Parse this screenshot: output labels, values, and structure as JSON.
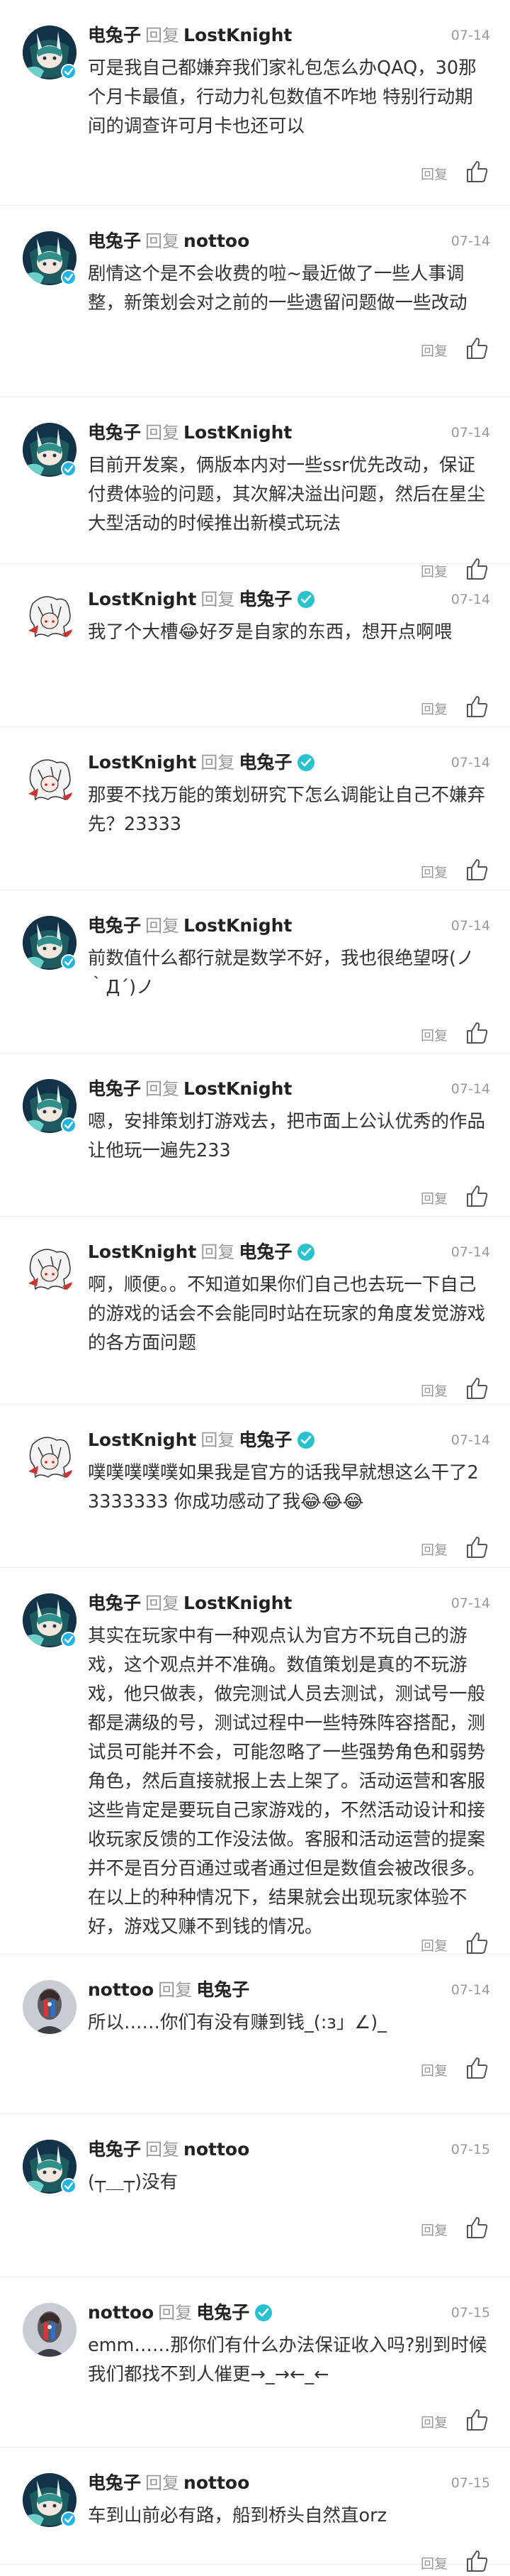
{
  "ui": {
    "reply_word": "回复",
    "reply_button": "回复"
  },
  "comments": [
    {
      "author": "电兔子",
      "author_avatar": "rabbit",
      "target": "LostKnight",
      "date": "07-14",
      "text": "可是我自己都嫌弃我们家礼包怎么办QAQ，30那个月卡最值，行动力礼包数值不咋地 特别行动期间的调查许可月卡也还可以"
    },
    {
      "author": "电兔子",
      "author_avatar": "rabbit",
      "target": "nottoo",
      "date": "07-14",
      "text": "剧情这个是不会收费的啦~最近做了一些人事调整，新策划会对之前的一些遗留问题做一些改动"
    },
    {
      "author": "电兔子",
      "author_avatar": "rabbit",
      "target": "LostKnight",
      "date": "07-14",
      "text": "目前开发案，俩版本内对一些ssr优先改动，保证付费体验的问题，其次解决溢出问题，然后在星尘大型活动的时候推出新模式玩法"
    },
    {
      "author": "LostKnight",
      "author_avatar": "knight",
      "target": "电兔子",
      "target_verified": true,
      "date": "07-14",
      "text": "我了个大槽😂好歹是自家的东西，想开点啊喂"
    },
    {
      "author": "LostKnight",
      "author_avatar": "knight",
      "target": "电兔子",
      "target_verified": true,
      "date": "07-14",
      "text": "那要不找万能的策划研究下怎么调能让自己不嫌弃先？23333"
    },
    {
      "author": "电兔子",
      "author_avatar": "rabbit",
      "target": "LostKnight",
      "date": "07-14",
      "text": "前数值什么都行就是数学不好，我也很绝望呀(ノ｀Д´)ノ"
    },
    {
      "author": "电兔子",
      "author_avatar": "rabbit",
      "target": "LostKnight",
      "date": "07-14",
      "text": "嗯，安排策划打游戏去，把市面上公认优秀的作品让他玩一遍先233"
    },
    {
      "author": "LostKnight",
      "author_avatar": "knight",
      "target": "电兔子",
      "target_verified": true,
      "date": "07-14",
      "text": "啊，顺便。。不知道如果你们自己也去玩一下自己的游戏的话会不会能同时站在玩家的角度发觉游戏的各方面问题"
    },
    {
      "author": "LostKnight",
      "author_avatar": "knight",
      "target": "电兔子",
      "target_verified": true,
      "date": "07-14",
      "text": "噗噗噗噗噗如果我是官方的话我早就想这么干了23333333 你成功感动了我😂😂😂"
    },
    {
      "author": "电兔子",
      "author_avatar": "rabbit",
      "target": "LostKnight",
      "date": "07-14",
      "text": "其实在玩家中有一种观点认为官方不玩自己的游戏，这个观点并不准确。数值策划是真的不玩游戏，他只做表，做完测试人员去测试，测试号一般都是满级的号，测试过程中一些特殊阵容搭配，测试员可能并不会，可能忽略了一些强势角色和弱势角色，然后直接就报上去上架了。活动运营和客服这些肯定是要玩自己家游戏的，不然活动设计和接收玩家反馈的工作没法做。客服和活动运营的提案并不是百分百通过或者通过但是数值会被改很多。在以上的种种情况下，结果就会出现玩家体验不好，游戏又赚不到钱的情况。"
    },
    {
      "author": "nottoo",
      "author_avatar": "nottoo",
      "target": "电兔子",
      "target_verified": false,
      "date": "07-14",
      "text": "所以……你们有没有赚到钱_(:з」∠)_"
    },
    {
      "author": "电兔子",
      "author_avatar": "rabbit",
      "target": "nottoo",
      "date": "07-15",
      "text": "(┬＿┬)没有"
    },
    {
      "author": "nottoo",
      "author_avatar": "nottoo",
      "target": "电兔子",
      "target_verified": true,
      "date": "07-15",
      "text": "emm……那你们有什么办法保证收入吗?别到时候我们都找不到人催更→_→←_←"
    },
    {
      "author": "电兔子",
      "author_avatar": "rabbit",
      "target": "nottoo",
      "date": "07-15",
      "text": "车到山前必有路，船到桥头自然直orz"
    }
  ]
}
